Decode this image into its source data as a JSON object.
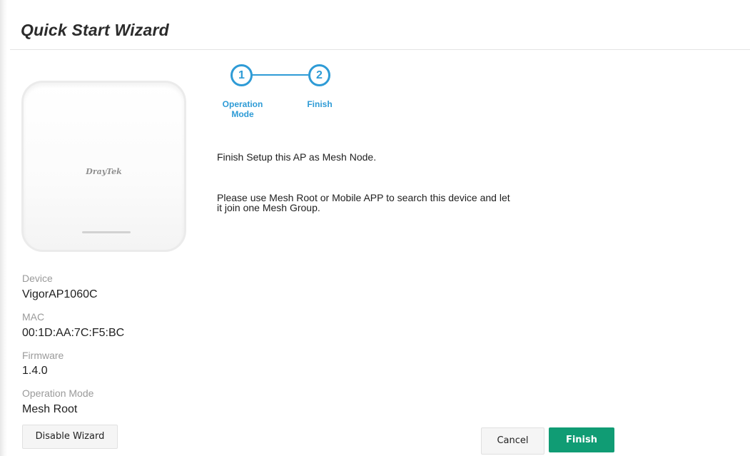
{
  "header": {
    "title": "Quick Start Wizard"
  },
  "device_image": {
    "brand": "DrayTek"
  },
  "device_info": {
    "device_label": "Device",
    "device_value": "VigorAP1060C",
    "mac_label": "MAC",
    "mac_value": "00:1D:AA:7C:F5:BC",
    "firmware_label": "Firmware",
    "firmware_value": "1.4.0",
    "operation_mode_label": "Operation Mode",
    "operation_mode_value": "Mesh Root"
  },
  "stepper": {
    "steps": [
      {
        "number": "1",
        "label_line1": "Operation",
        "label_line2": "Mode"
      },
      {
        "number": "2",
        "label_line1": "Finish",
        "label_line2": ""
      }
    ]
  },
  "content": {
    "finish_message": "Finish Setup this AP as Mesh Node.",
    "instruction": "Please use Mesh Root or Mobile APP to search this device and let it join one Mesh Group."
  },
  "buttons": {
    "disable_wizard": "Disable Wizard",
    "cancel": "Cancel",
    "finish": "Finish"
  },
  "colors": {
    "accent_blue": "#2e9bd6",
    "finish_green": "#109c74"
  },
  "icons": {
    "step_indicator": "numbered-circle-icon"
  }
}
